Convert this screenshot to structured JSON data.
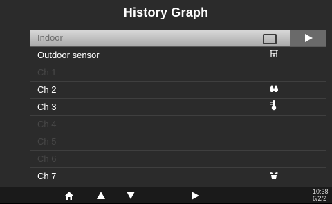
{
  "header": {
    "title": "History Graph"
  },
  "colors": {
    "enabled_text": "#ffffff",
    "disabled_text": "#474747",
    "selected_gradient": "#d9d9d9-#a9a9a9"
  },
  "list": {
    "items": [
      {
        "label": "Indoor",
        "state": "selected",
        "icon": "rectangle-icon"
      },
      {
        "label": "Outdoor sensor",
        "state": "enabled",
        "icon": "weather-station-icon"
      },
      {
        "label": "Ch 1",
        "state": "disabled",
        "icon": ""
      },
      {
        "label": "Ch 2",
        "state": "enabled",
        "icon": "water-drops-icon"
      },
      {
        "label": "Ch 3",
        "state": "enabled",
        "icon": "thermometer-icon"
      },
      {
        "label": "Ch 4",
        "state": "disabled",
        "icon": ""
      },
      {
        "label": "Ch 5",
        "state": "disabled",
        "icon": ""
      },
      {
        "label": "Ch 6",
        "state": "disabled",
        "icon": ""
      },
      {
        "label": "Ch 7",
        "state": "enabled",
        "icon": "plant-pot-icon"
      }
    ]
  },
  "bottom_bar": {
    "icons": [
      "home-icon",
      "up-arrow-icon",
      "down-arrow-icon",
      "play-icon"
    ],
    "clock": {
      "time": "10:38",
      "date": "6/2/2"
    }
  }
}
